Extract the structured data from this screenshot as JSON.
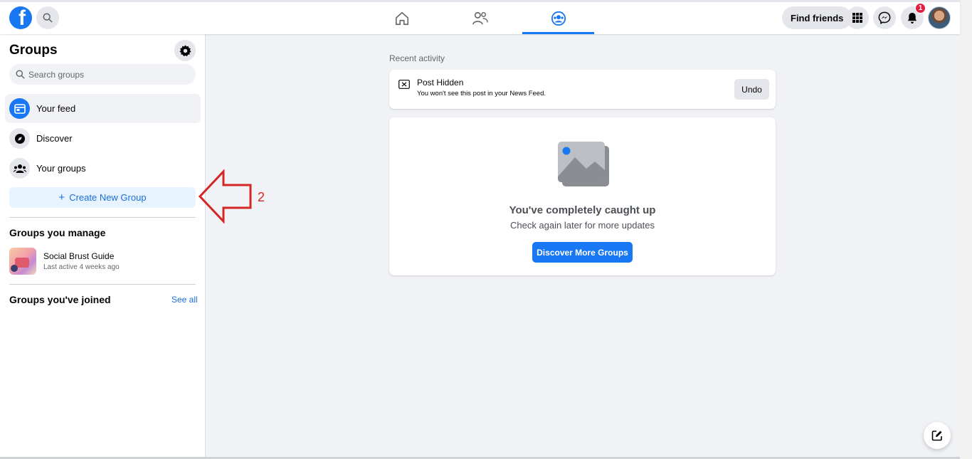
{
  "topbar": {
    "logo_letter": "f",
    "find_friends_label": "Find friends",
    "notification_count": "1",
    "nav_tabs": [
      "home",
      "friends",
      "groups"
    ],
    "active_tab": "groups"
  },
  "sidebar": {
    "title": "Groups",
    "search_placeholder": "Search groups",
    "items": [
      {
        "label": "Your feed",
        "icon": "feed-icon"
      },
      {
        "label": "Discover",
        "icon": "compass-icon"
      },
      {
        "label": "Your groups",
        "icon": "groups-icon"
      }
    ],
    "create_button_label": "Create New Group",
    "manage_section_title": "Groups you manage",
    "managed_groups": [
      {
        "name": "Social Brust Guide",
        "last_active": "Last active 4 weeks ago"
      }
    ],
    "joined_section_title": "Groups you've joined",
    "see_all_label": "See all"
  },
  "annotation": {
    "number": "2",
    "color": "#d42626"
  },
  "main": {
    "recent_activity_label": "Recent activity",
    "hidden_post": {
      "title": "Post Hidden",
      "subtitle": "You won't see this post in your News Feed.",
      "undo_label": "Undo"
    },
    "caught_up": {
      "title": "You've completely caught up",
      "subtitle": "Check again later for more updates",
      "button_label": "Discover More Groups"
    }
  },
  "colors": {
    "brand_blue": "#1877f2",
    "background": "#f0f2f5",
    "badge_red": "#e41e3f"
  }
}
